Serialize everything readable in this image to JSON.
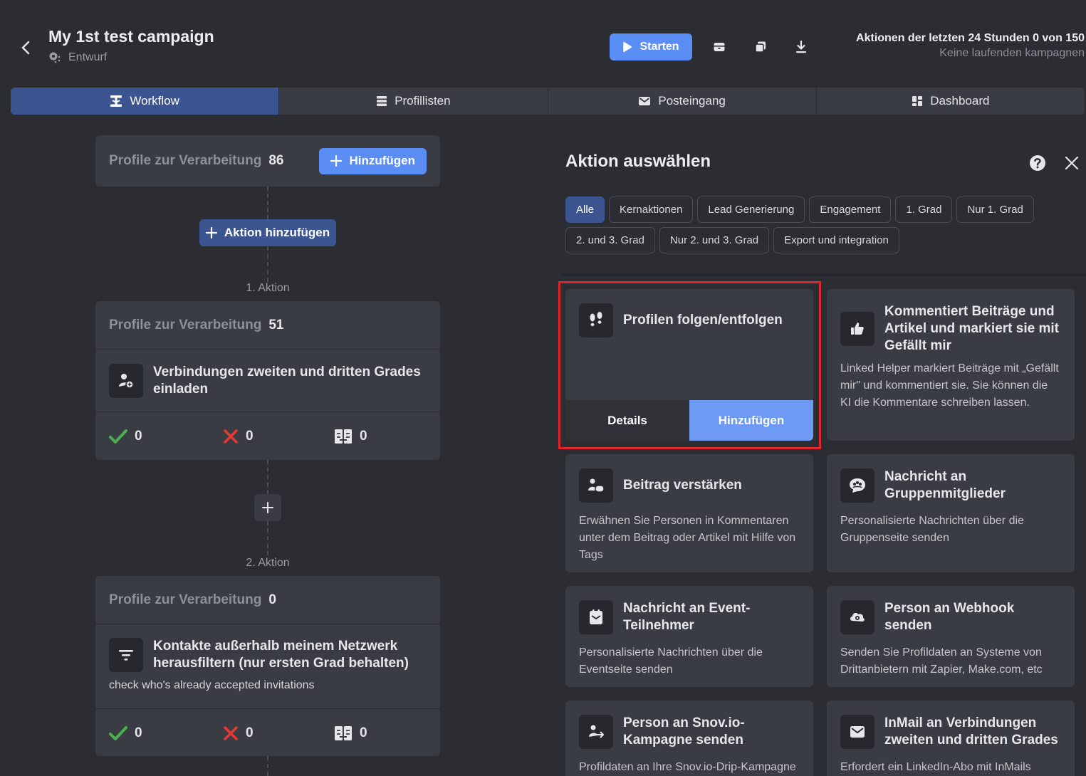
{
  "header": {
    "title": "My 1st test campaign",
    "status": "Entwurf",
    "start_label": "Starten",
    "actions_line": "Aktionen der letzten 24 Stunden 0 von 150",
    "running_line": "Keine laufenden kampagnen"
  },
  "tabs": [
    {
      "label": "Workflow",
      "icon": "workflow-icon"
    },
    {
      "label": "Profillisten",
      "icon": "list-icon"
    },
    {
      "label": "Posteingang",
      "icon": "mail-icon"
    },
    {
      "label": "Dashboard",
      "icon": "dashboard-icon"
    }
  ],
  "workflow": {
    "source": {
      "label": "Profile zur Verarbeitung",
      "count": "86",
      "add_label": "Hinzufügen"
    },
    "add_action_label": "Aktion hinzufügen",
    "steps": [
      {
        "step_label": "1. Aktion",
        "queue_label": "Profile zur Verarbeitung",
        "queue_count": "51",
        "title": "Verbindungen zweiten und dritten Grades einladen",
        "note": "",
        "success": "0",
        "failed": "0",
        "skipped": "0"
      },
      {
        "step_label": "2. Aktion",
        "queue_label": "Profile zur Verarbeitung",
        "queue_count": "0",
        "title": "Kontakte außerhalb meinem Netzwerk herausfiltern (nur ersten Grad behalten)",
        "note": "check who's already accepted invitations",
        "success": "0",
        "failed": "0",
        "skipped": "0"
      }
    ]
  },
  "panel": {
    "title": "Aktion auswählen",
    "filters_row1": [
      "Alle",
      "Kernaktionen",
      "Lead Generierung",
      "Engagement",
      "1. Grad",
      "Nur 1. Grad"
    ],
    "filters_row2": [
      "2. und 3. Grad",
      "Nur 2. und 3. Grad",
      "Export und integration"
    ],
    "selected_card": {
      "title": "Profilen folgen/entfolgen",
      "details_label": "Details",
      "add_label": "Hinzufügen"
    },
    "cards": [
      {
        "title": "Kommentiert Beiträge und Artikel und markiert sie mit Gefällt mir",
        "desc": "Linked Helper markiert Beiträge mit „Gefällt mir\" und kommentiert sie. Sie können die KI die Kommentare schreiben lassen."
      },
      {
        "title": "Beitrag verstärken",
        "desc": "Erwähnen Sie Personen in Kommentaren unter dem Beitrag oder Artikel mit Hilfe von Tags"
      },
      {
        "title": "Nachricht an Gruppenmitglieder",
        "desc": "Personalisierte Nachrichten über die Gruppenseite senden"
      },
      {
        "title": "Nachricht an Event-Teilnehmer",
        "desc": "Personalisierte Nachrichten über die Eventseite senden"
      },
      {
        "title": "Person an Webhook senden",
        "desc": "Senden Sie Profildaten an Systeme von Drittanbietern mit Zapier, Make.com, etc"
      },
      {
        "title": "Person an Snov.io-Kampagne senden",
        "desc": "Profildaten an Ihre Snov.io-Drip-Kampagne senden"
      },
      {
        "title": "InMail an Verbindungen zweiten und dritten Grades",
        "desc": "Erfordert ein LinkedIn-Abo mit InMails"
      }
    ]
  },
  "colors": {
    "accent": "#5b8ef5",
    "active_tab": "#3c5490",
    "background": "#2b2d33",
    "card": "#3a3c43",
    "highlight": "#e0242b",
    "success": "#4caf50",
    "fail": "#e53935"
  }
}
